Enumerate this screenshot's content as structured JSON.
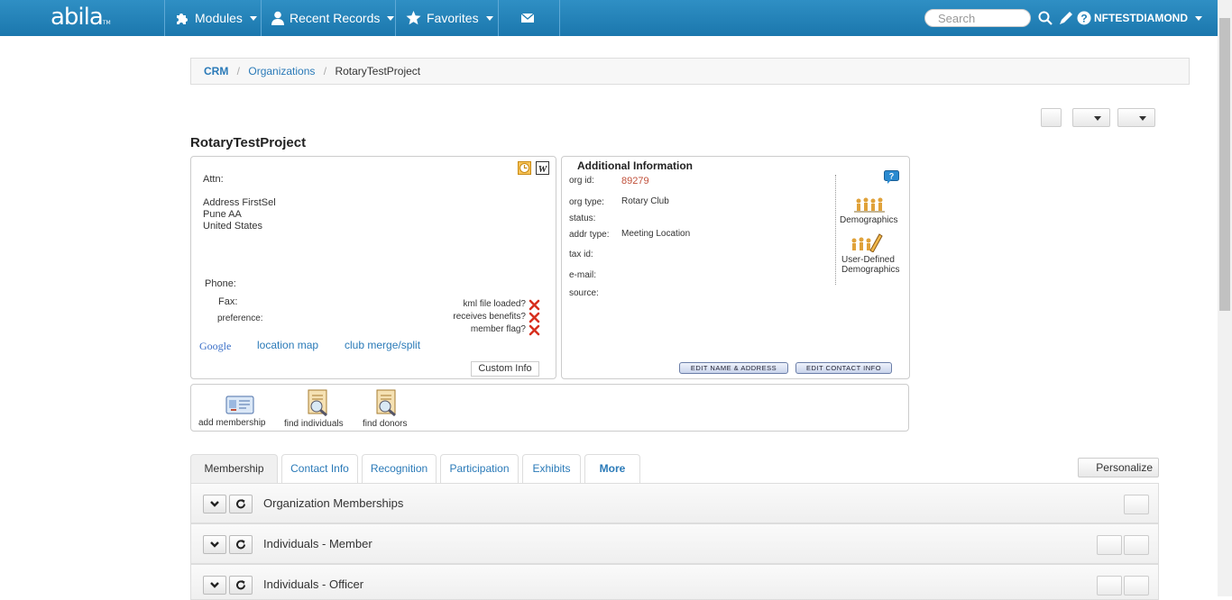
{
  "nav": {
    "logo": "abila",
    "logo_tm": "TM",
    "modules": "Modules",
    "recent": "Recent Records",
    "favorites": "Favorites",
    "search_placeholder": "Search",
    "user": "NFTESTDIAMOND"
  },
  "breadcrumb": {
    "crm": "CRM",
    "orgs": "Organizations",
    "current": "RotaryTestProject",
    "sep": "/"
  },
  "page": {
    "title": "RotaryTestProject"
  },
  "address": {
    "attn": "Attn:",
    "line1": "Address FirstSel",
    "line2": "Pune AA",
    "line3": "United States",
    "phone": "Phone:",
    "fax": "Fax:",
    "preference": "preference:",
    "kml": "kml file loaded?",
    "benefits": "receives benefits?",
    "member_flag": "member flag?",
    "google": "Google",
    "location_map": "location map",
    "club_merge": "club merge/split",
    "custom_info": "Custom Info"
  },
  "additional": {
    "title": "Additional Information",
    "org_id_label": "org id:",
    "org_id": "89279",
    "org_type_label": "org type:",
    "org_type": "Rotary Club",
    "status_label": "status:",
    "addr_type_label": "addr type:",
    "addr_type": "Meeting Location",
    "tax_id_label": "tax id:",
    "email_label": "e-mail:",
    "source_label": "source:",
    "demographics": "Demographics",
    "udd1": "User-Defined",
    "udd2": "Demographics",
    "edit_name": "EDIT NAME & ADDRESS",
    "edit_contact": "EDIT CONTACT INFO"
  },
  "actions": {
    "add_membership": "add membership",
    "find_individuals": "find individuals",
    "find_donors": "find donors"
  },
  "tabs": [
    "Membership",
    "Contact Info",
    "Recognition",
    "Participation",
    "Exhibits",
    "More"
  ],
  "personalize": "Personalize",
  "sections": [
    "Organization Memberships",
    "Individuals - Member",
    "Individuals - Officer"
  ],
  "colors": {
    "nav": "#1b77ad",
    "link": "#2a7ab8",
    "org_id": "#c0503a",
    "x_mark": "#d7301f"
  }
}
